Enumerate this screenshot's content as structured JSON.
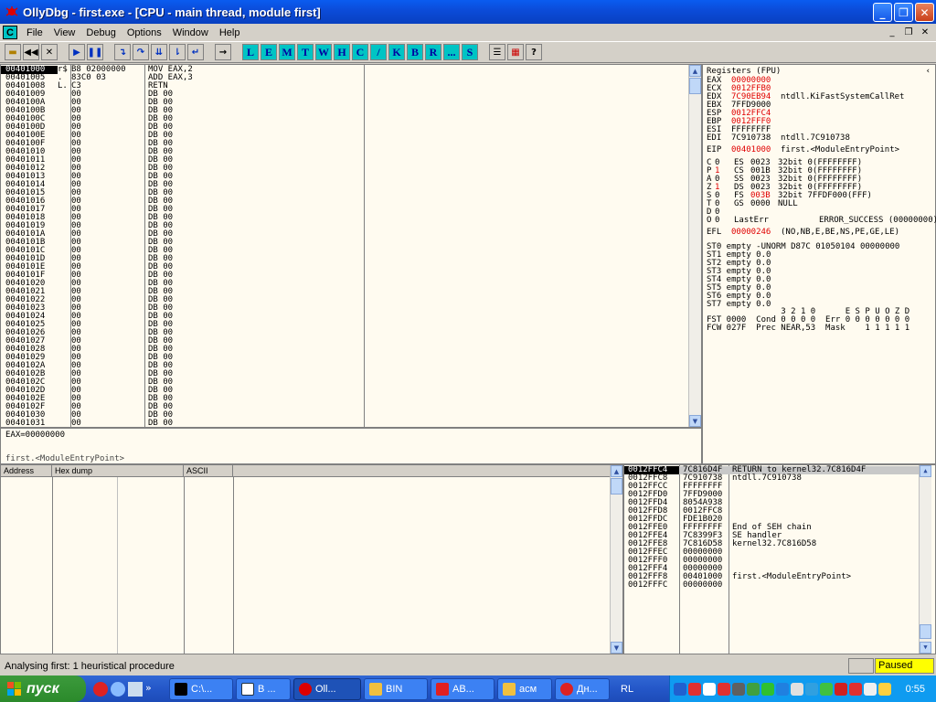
{
  "window": {
    "title": "OllyDbg - first.exe - [CPU - main thread, module first]"
  },
  "menu": [
    "File",
    "View",
    "Debug",
    "Options",
    "Window",
    "Help"
  ],
  "toolbar": {
    "letters": [
      "L",
      "E",
      "M",
      "T",
      "W",
      "H",
      "C",
      "/",
      "K",
      "B",
      "R",
      "...",
      "S"
    ],
    "icons": [
      "open-icon",
      "rewind-icon",
      "close-icon",
      "run-icon",
      "pause-icon",
      "step-into-icon",
      "step-over-icon",
      "trace-into-icon",
      "trace-over-icon",
      "execute-till-return-icon",
      "goto-icon"
    ]
  },
  "disasm": {
    "rows": [
      {
        "addr": "00401000",
        "mark": "r$",
        "hex": "B8 02000000",
        "cmd": "MOV EAX,2",
        "selected": true
      },
      {
        "addr": "00401005",
        "mark": ".",
        "hex": "83C0 03",
        "cmd": "ADD EAX,3"
      },
      {
        "addr": "00401008",
        "mark": "L.",
        "hex": "C3",
        "cmd": "RETN"
      },
      {
        "addr": "00401009",
        "mark": "",
        "hex": "00",
        "cmd": "DB 00"
      },
      {
        "addr": "0040100A",
        "mark": "",
        "hex": "00",
        "cmd": "DB 00"
      },
      {
        "addr": "0040100B",
        "mark": "",
        "hex": "00",
        "cmd": "DB 00"
      },
      {
        "addr": "0040100C",
        "mark": "",
        "hex": "00",
        "cmd": "DB 00"
      },
      {
        "addr": "0040100D",
        "mark": "",
        "hex": "00",
        "cmd": "DB 00"
      },
      {
        "addr": "0040100E",
        "mark": "",
        "hex": "00",
        "cmd": "DB 00"
      },
      {
        "addr": "0040100F",
        "mark": "",
        "hex": "00",
        "cmd": "DB 00"
      },
      {
        "addr": "00401010",
        "mark": "",
        "hex": "00",
        "cmd": "DB 00"
      },
      {
        "addr": "00401011",
        "mark": "",
        "hex": "00",
        "cmd": "DB 00"
      },
      {
        "addr": "00401012",
        "mark": "",
        "hex": "00",
        "cmd": "DB 00"
      },
      {
        "addr": "00401013",
        "mark": "",
        "hex": "00",
        "cmd": "DB 00"
      },
      {
        "addr": "00401014",
        "mark": "",
        "hex": "00",
        "cmd": "DB 00"
      },
      {
        "addr": "00401015",
        "mark": "",
        "hex": "00",
        "cmd": "DB 00"
      },
      {
        "addr": "00401016",
        "mark": "",
        "hex": "00",
        "cmd": "DB 00"
      },
      {
        "addr": "00401017",
        "mark": "",
        "hex": "00",
        "cmd": "DB 00"
      },
      {
        "addr": "00401018",
        "mark": "",
        "hex": "00",
        "cmd": "DB 00"
      },
      {
        "addr": "00401019",
        "mark": "",
        "hex": "00",
        "cmd": "DB 00"
      },
      {
        "addr": "0040101A",
        "mark": "",
        "hex": "00",
        "cmd": "DB 00"
      },
      {
        "addr": "0040101B",
        "mark": "",
        "hex": "00",
        "cmd": "DB 00"
      },
      {
        "addr": "0040101C",
        "mark": "",
        "hex": "00",
        "cmd": "DB 00"
      },
      {
        "addr": "0040101D",
        "mark": "",
        "hex": "00",
        "cmd": "DB 00"
      },
      {
        "addr": "0040101E",
        "mark": "",
        "hex": "00",
        "cmd": "DB 00"
      },
      {
        "addr": "0040101F",
        "mark": "",
        "hex": "00",
        "cmd": "DB 00"
      },
      {
        "addr": "00401020",
        "mark": "",
        "hex": "00",
        "cmd": "DB 00"
      },
      {
        "addr": "00401021",
        "mark": "",
        "hex": "00",
        "cmd": "DB 00"
      },
      {
        "addr": "00401022",
        "mark": "",
        "hex": "00",
        "cmd": "DB 00"
      },
      {
        "addr": "00401023",
        "mark": "",
        "hex": "00",
        "cmd": "DB 00"
      },
      {
        "addr": "00401024",
        "mark": "",
        "hex": "00",
        "cmd": "DB 00"
      },
      {
        "addr": "00401025",
        "mark": "",
        "hex": "00",
        "cmd": "DB 00"
      },
      {
        "addr": "00401026",
        "mark": "",
        "hex": "00",
        "cmd": "DB 00"
      },
      {
        "addr": "00401027",
        "mark": "",
        "hex": "00",
        "cmd": "DB 00"
      },
      {
        "addr": "00401028",
        "mark": "",
        "hex": "00",
        "cmd": "DB 00"
      },
      {
        "addr": "00401029",
        "mark": "",
        "hex": "00",
        "cmd": "DB 00"
      },
      {
        "addr": "0040102A",
        "mark": "",
        "hex": "00",
        "cmd": "DB 00"
      },
      {
        "addr": "0040102B",
        "mark": "",
        "hex": "00",
        "cmd": "DB 00"
      },
      {
        "addr": "0040102C",
        "mark": "",
        "hex": "00",
        "cmd": "DB 00"
      },
      {
        "addr": "0040102D",
        "mark": "",
        "hex": "00",
        "cmd": "DB 00"
      },
      {
        "addr": "0040102E",
        "mark": "",
        "hex": "00",
        "cmd": "DB 00"
      },
      {
        "addr": "0040102F",
        "mark": "",
        "hex": "00",
        "cmd": "DB 00"
      },
      {
        "addr": "00401030",
        "mark": "",
        "hex": "00",
        "cmd": "DB 00"
      },
      {
        "addr": "00401031",
        "mark": "",
        "hex": "00",
        "cmd": "DB 00"
      }
    ]
  },
  "info": {
    "line1": "EAX=00000000",
    "line2": "first.<ModuleEntryPoint>"
  },
  "registers": {
    "title": "Registers (FPU)",
    "gp": [
      {
        "name": "EAX",
        "value": "00000000",
        "note": "",
        "changed": true
      },
      {
        "name": "ECX",
        "value": "0012FFB0",
        "note": "",
        "changed": true
      },
      {
        "name": "EDX",
        "value": "7C90EB94",
        "note": "ntdll.KiFastSystemCallRet",
        "changed": true
      },
      {
        "name": "EBX",
        "value": "7FFD9000",
        "note": "",
        "changed": false
      },
      {
        "name": "ESP",
        "value": "0012FFC4",
        "note": "",
        "changed": true
      },
      {
        "name": "EBP",
        "value": "0012FFF0",
        "note": "",
        "changed": true
      },
      {
        "name": "ESI",
        "value": "FFFFFFFF",
        "note": "",
        "changed": false
      },
      {
        "name": "EDI",
        "value": "7C910738",
        "note": "ntdll.7C910738",
        "changed": false
      }
    ],
    "eip": {
      "name": "EIP",
      "value": "00401000",
      "note": "first.<ModuleEntryPoint>"
    },
    "flags": [
      {
        "f": "C",
        "v": "0",
        "seg": "ES",
        "sv": "0023",
        "desc": "32bit 0(FFFFFFFF)"
      },
      {
        "f": "P",
        "v": "1",
        "seg": "CS",
        "sv": "001B",
        "desc": "32bit 0(FFFFFFFF)"
      },
      {
        "f": "A",
        "v": "0",
        "seg": "SS",
        "sv": "0023",
        "desc": "32bit 0(FFFFFFFF)"
      },
      {
        "f": "Z",
        "v": "1",
        "seg": "DS",
        "sv": "0023",
        "desc": "32bit 0(FFFFFFFF)"
      },
      {
        "f": "S",
        "v": "0",
        "seg": "FS",
        "sv": "003B",
        "desc": "32bit 7FFDF000(FFF)"
      },
      {
        "f": "T",
        "v": "0",
        "seg": "GS",
        "sv": "0000",
        "desc": "NULL"
      },
      {
        "f": "D",
        "v": "0",
        "seg": "",
        "sv": "",
        "desc": ""
      },
      {
        "f": "O",
        "v": "0",
        "seg": "LastErr",
        "sv": "",
        "desc": "ERROR_SUCCESS (00000000)"
      }
    ],
    "efl": {
      "name": "EFL",
      "value": "00000246",
      "note": "(NO,NB,E,BE,NS,PE,GE,LE)"
    },
    "st": [
      "ST0 empty -UNORM D87C 01050104 00000000",
      "ST1 empty 0.0",
      "ST2 empty 0.0",
      "ST3 empty 0.0",
      "ST4 empty 0.0",
      "ST5 empty 0.0",
      "ST6 empty 0.0",
      "ST7 empty 0.0"
    ],
    "fpu_hdr": "               3 2 1 0      E S P U O Z D",
    "fst": "FST 0000  Cond 0 0 0 0  Err 0 0 0 0 0 0 0",
    "fcw": "FCW 027F  Prec NEAR,53  Mask    1 1 1 1 1"
  },
  "dump": {
    "headers": [
      "Address",
      "Hex dump",
      "ASCII"
    ]
  },
  "stack": {
    "rows": [
      {
        "addr": "0012FFC4",
        "val": "7C816D4F",
        "note": "RETURN to kernel32.7C816D4F",
        "selected": true
      },
      {
        "addr": "0012FFC8",
        "val": "7C910738",
        "note": "ntdll.7C910738"
      },
      {
        "addr": "0012FFCC",
        "val": "FFFFFFFF",
        "note": ""
      },
      {
        "addr": "0012FFD0",
        "val": "7FFD9000",
        "note": ""
      },
      {
        "addr": "0012FFD4",
        "val": "8054A938",
        "note": ""
      },
      {
        "addr": "0012FFD8",
        "val": "0012FFC8",
        "note": ""
      },
      {
        "addr": "0012FFDC",
        "val": "FDE1B020",
        "note": ""
      },
      {
        "addr": "0012FFE0",
        "val": "FFFFFFFF",
        "note": "End of SEH chain"
      },
      {
        "addr": "0012FFE4",
        "val": "7C8399F3",
        "note": "SE handler"
      },
      {
        "addr": "0012FFE8",
        "val": "7C816D58",
        "note": "kernel32.7C816D58"
      },
      {
        "addr": "0012FFEC",
        "val": "00000000",
        "note": ""
      },
      {
        "addr": "0012FFF0",
        "val": "00000000",
        "note": ""
      },
      {
        "addr": "0012FFF4",
        "val": "00000000",
        "note": ""
      },
      {
        "addr": "0012FFF8",
        "val": "00401000",
        "note": "first.<ModuleEntryPoint>"
      },
      {
        "addr": "0012FFFC",
        "val": "00000000",
        "note": ""
      }
    ]
  },
  "status": {
    "message": "Analysing first: 1 heuristical procedure",
    "state": "Paused"
  },
  "taskbar": {
    "start": "пуск",
    "buttons": [
      "C:\\...",
      "В ...",
      "Oll...",
      "BIN",
      "AB...",
      "асм",
      "Дн..."
    ],
    "lang": "RL",
    "clock": "0:55"
  }
}
